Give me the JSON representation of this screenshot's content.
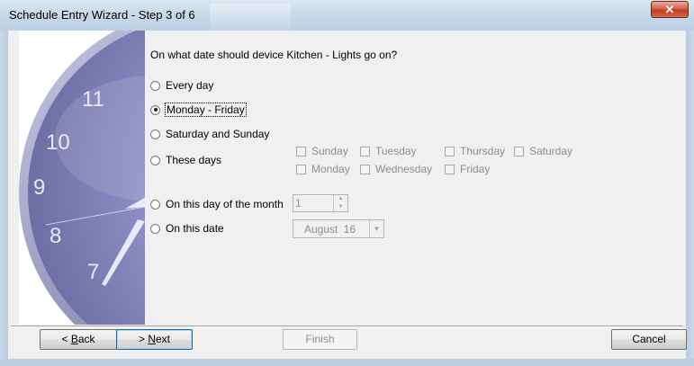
{
  "window": {
    "title": "Schedule Entry Wizard - Step 3 of 6",
    "close_glyph": "✕"
  },
  "question": "On what date should device Kitchen - Lights go on?",
  "options": [
    {
      "label": "Every day",
      "checked": false
    },
    {
      "label": "Monday - Friday",
      "checked": true
    },
    {
      "label": "Saturday and Sunday",
      "checked": false
    },
    {
      "label": "These days",
      "checked": false
    },
    {
      "label": "On this day of the month",
      "checked": false
    },
    {
      "label": "On this date",
      "checked": false
    }
  ],
  "days": {
    "row1": [
      "Sunday",
      "Tuesday",
      "Thursday",
      "Saturday"
    ],
    "row2": [
      "Monday",
      "Wednesday",
      "Friday"
    ]
  },
  "day_of_month": {
    "value": "1"
  },
  "date": {
    "month": "August",
    "day": "16"
  },
  "clock_numbers": [
    "11",
    "10",
    "9",
    "8",
    "7"
  ],
  "buttons": {
    "back_accel": "B",
    "back_rest": "ack",
    "next_accel": "N",
    "next_rest": "ext",
    "finish": "Finish",
    "cancel": "Cancel"
  },
  "colors": {
    "clock_face": "#8e8fc4",
    "clock_rim": "#6d6f9e"
  },
  "icons": {
    "close": "close-icon",
    "clock": "clock-graphic",
    "radio": "radio-icon"
  }
}
